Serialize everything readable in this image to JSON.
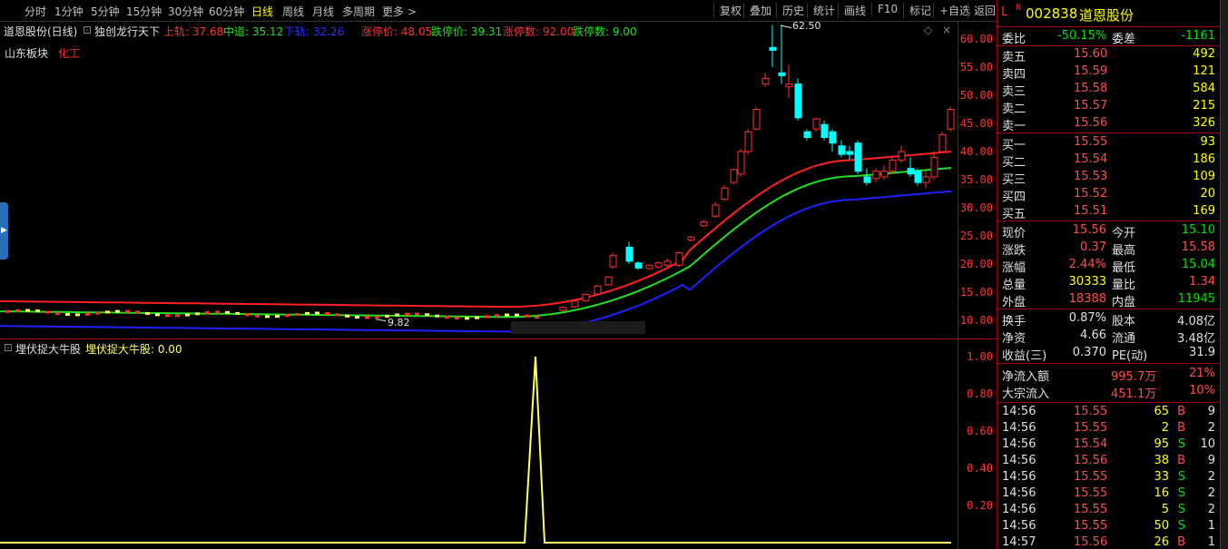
{
  "toolbar": {
    "periods": [
      "分时",
      "1分钟",
      "5分钟",
      "15分钟",
      "30分钟",
      "60分钟",
      "日线",
      "周线",
      "月线",
      "多周期",
      "更多 >"
    ],
    "active_period": "日线",
    "tools": [
      "复权",
      "叠加",
      "历史",
      "统计",
      "画线",
      "F10",
      "标记",
      "+自选",
      "返回"
    ]
  },
  "main_chart": {
    "stock_name": "道恩股份(日线)",
    "indicator_name": "独创龙行天下",
    "upper_label": "上轨: 37.68",
    "middle_label": "中道: 35.12",
    "lower_label": "下轨: 32.26",
    "limit_up_price": "涨停价: 48.05",
    "limit_down_price": "跌停价: 39.31",
    "limit_up_count": "涨停数: 92.00",
    "limit_down_count": "跌停数: 9.00",
    "sector": "山东板块",
    "industry": "化工",
    "high_marker": "62.50",
    "low_marker": "9.82",
    "y_axis": [
      "60.00",
      "55.00",
      "50.00",
      "45.00",
      "40.00",
      "35.00",
      "30.00",
      "25.00",
      "20.00",
      "15.00",
      "10.00"
    ],
    "colors": {
      "upper": "#ff2020",
      "middle": "#20e020",
      "lower": "#2020ff",
      "up_candle": "#ff3030",
      "down_candle": "#00ffff"
    }
  },
  "sub_chart": {
    "indicator_name": "埋伏捉大牛股",
    "value_label": "埋伏捉大牛股: 0.00",
    "y_axis": [
      "1.00",
      "0.80",
      "0.60",
      "0.40",
      "0.20"
    ],
    "line_color": "#ffff66"
  },
  "chart_data": {
    "type": "line",
    "title": "埋伏捉大牛股",
    "ylim": [
      0,
      1
    ],
    "series": [
      {
        "name": "埋伏捉大牛股",
        "values": [
          0,
          0,
          1,
          0,
          0
        ]
      }
    ]
  },
  "panel": {
    "code": "002838",
    "name": "道恩股份",
    "flags": [
      "L",
      "R"
    ],
    "webi_label": "委比",
    "webi_value": "-50.15%",
    "weicha_label": "委差",
    "weicha_value": "-1161",
    "sell": [
      {
        "label": "卖五",
        "price": "15.60",
        "vol": "492"
      },
      {
        "label": "卖四",
        "price": "15.59",
        "vol": "121"
      },
      {
        "label": "卖三",
        "price": "15.58",
        "vol": "584"
      },
      {
        "label": "卖二",
        "price": "15.57",
        "vol": "215"
      },
      {
        "label": "卖一",
        "price": "15.56",
        "vol": "326"
      }
    ],
    "buy": [
      {
        "label": "买一",
        "price": "15.55",
        "vol": "93"
      },
      {
        "label": "买二",
        "price": "15.54",
        "vol": "186"
      },
      {
        "label": "买三",
        "price": "15.53",
        "vol": "109"
      },
      {
        "label": "买四",
        "price": "15.52",
        "vol": "20"
      },
      {
        "label": "买五",
        "price": "15.51",
        "vol": "169"
      }
    ],
    "stats": [
      {
        "l1": "现价",
        "v1": "15.56",
        "c1": "red",
        "l2": "今开",
        "v2": "15.10",
        "c2": "green"
      },
      {
        "l1": "涨跌",
        "v1": "0.37",
        "c1": "red",
        "l2": "最高",
        "v2": "15.58",
        "c2": "red"
      },
      {
        "l1": "涨幅",
        "v1": "2.44%",
        "c1": "red",
        "l2": "最低",
        "v2": "15.04",
        "c2": "green"
      },
      {
        "l1": "总量",
        "v1": "30333",
        "c1": "yellow",
        "l2": "量比",
        "v2": "1.34",
        "c2": "red"
      },
      {
        "l1": "外盘",
        "v1": "18388",
        "c1": "red",
        "l2": "内盘",
        "v2": "11945",
        "c2": "green"
      }
    ],
    "stats2": [
      {
        "l1": "换手",
        "v1": "0.87%",
        "l2": "股本",
        "v2": "4.08亿"
      },
      {
        "l1": "净资",
        "v1": "4.66",
        "l2": "流通",
        "v2": "3.48亿"
      },
      {
        "l1": "收益(三)",
        "v1": "0.370",
        "l2": "PE(动)",
        "v2": "31.9"
      }
    ],
    "flow": [
      {
        "label": "净流入额",
        "value": "995.7万",
        "pct": "21%"
      },
      {
        "label": "大宗流入",
        "value": "451.1万",
        "pct": "10%"
      }
    ],
    "ticks": [
      {
        "time": "14:56",
        "price": "15.55",
        "vol": "65",
        "side": "B",
        "n": "9"
      },
      {
        "time": "14:56",
        "price": "15.55",
        "vol": "2",
        "side": "B",
        "n": "2"
      },
      {
        "time": "14:56",
        "price": "15.54",
        "vol": "95",
        "side": "S",
        "n": "10"
      },
      {
        "time": "14:56",
        "price": "15.56",
        "vol": "38",
        "side": "B",
        "n": "9"
      },
      {
        "time": "14:56",
        "price": "15.55",
        "vol": "33",
        "side": "S",
        "n": "2"
      },
      {
        "time": "14:56",
        "price": "15.55",
        "vol": "16",
        "side": "S",
        "n": "2"
      },
      {
        "time": "14:56",
        "price": "15.55",
        "vol": "5",
        "side": "S",
        "n": "2"
      },
      {
        "time": "14:56",
        "price": "15.55",
        "vol": "50",
        "side": "S",
        "n": "1"
      },
      {
        "time": "14:57",
        "price": "15.56",
        "vol": "26",
        "side": "B",
        "n": "1"
      }
    ]
  }
}
